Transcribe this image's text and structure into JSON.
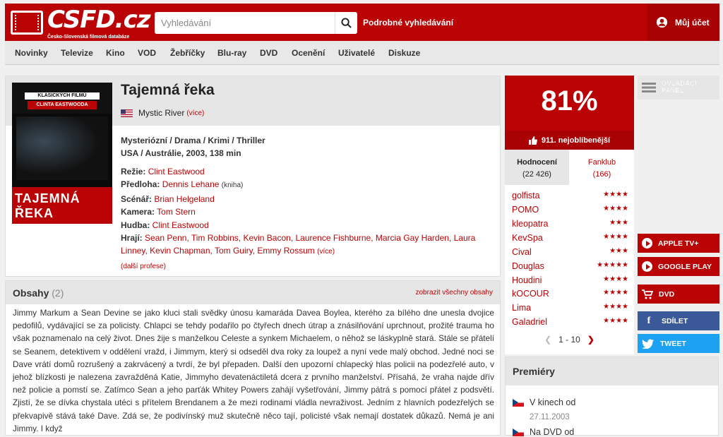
{
  "header": {
    "logo_text": "CSFD.cz",
    "logo_subtitle": "Česko-Slovenská filmová databáze",
    "search_placeholder": "Vyhledávání",
    "advanced_search": "Podrobné vyhledávání",
    "account_label": "Můj účet"
  },
  "nav": [
    "Novinky",
    "Televize",
    "Kino",
    "VOD",
    "Žebříčky",
    "Blu-ray",
    "DVD",
    "Ocenění",
    "Uživatelé",
    "Diskuze"
  ],
  "poster": {
    "top_label": "KLASICKÝCH FILMŮ",
    "director_label": "CLINTA EASTWOODA",
    "title_label": "TAJEMNÁ ŘEKA"
  },
  "film": {
    "title": "Tajemná řeka",
    "original_title": "Mystic River",
    "original_more": "(více)",
    "genres": "Mysteriózní / Drama / Krimi / Thriller",
    "origin": "USA / Austrálie, 2003, 138 min",
    "credits": {
      "director_label": "Režie:",
      "director": "Clint Eastwood",
      "source_label": "Předloha:",
      "source": "Dennis Lehane",
      "source_note": "(kniha)",
      "writer_label": "Scénář:",
      "writer": "Brian Helgeland",
      "camera_label": "Kamera:",
      "camera": "Tom Stern",
      "music_label": "Hudba:",
      "music": "Clint Eastwood",
      "cast_label": "Hrají:",
      "cast_line1": "Sean Penn, Tim Robbins, Kevin Bacon, Laurence Fishburne, Marcia Gay Harden, Laura",
      "cast_line2": "Linney, Kevin Chapman, Tom Guiry, Emmy Rossum",
      "cast_more": "(více)",
      "more_professions": "(další profese)"
    }
  },
  "plot": {
    "heading": "Obsahy",
    "count": "(2)",
    "show_all": "zobrazit všechny obsahy",
    "text": "Jimmy Markum a Sean Devine se jako kluci stali svědky únosu kamaráda Davea Boylea, kterého za bílého dne unesla dvojice pedofilů, vydávající se za policisty. Chlapci se tehdy podařilo po čtyřech dnech útrap a znásilňování uprchnout, prožité trauma ho však poznamenalo na celý život. Dnes žije s manželkou Celeste a synkem Michaelem, o něhož se láskyplně stará. Stále se přátelí se Seanem, detektivem v oddělení vražd, i Jimmym, který si odseděl dva roky za loupež a nyní vede malý obchod. Jedné noci se Dave vrátí domů rozrušený a zakrvácený a tvrdí, že byl přepaden. Další den upozorní chlapecký hlas policii na podezřelé auto, v jehož blízkosti je nalezena zavražděná Katie, Jimmyho devatenáctiletá dcera z prvního manželství. Přísahá, že vraha najde dřív než policie a pomstí se. Zatímco Sean a jeho parťák Whitey Powers zahájí vyšetřování, Jimmy pátrá s pomocí přátel z podsvětí. Zjistí, že se dívka chystala utéci s přítelem Brendanem a že mezi rodinami vládla nevraživost. Jedním z hlavních podezřelých se překvapivě stává také Dave. Zdá se, že podivínský muž skutečně něco tají, policisté však nemají dostatek důkazů. Nemá je ani Jimmy. I když"
  },
  "rating": {
    "percent": "81%",
    "rank": "911. nejoblíbenější",
    "tab_ratings": "Hodnocení",
    "tab_ratings_count": "(22 426)",
    "tab_fanclub": "Fanklub",
    "tab_fanclub_count": "(166)",
    "users": [
      {
        "name": "golfista",
        "stars": "★★★★"
      },
      {
        "name": "POMO",
        "stars": "★★★★"
      },
      {
        "name": "kleopatra",
        "stars": "★★★"
      },
      {
        "name": "KevSpa",
        "stars": "★★★★"
      },
      {
        "name": "Cival",
        "stars": "★★★"
      },
      {
        "name": "Douglas",
        "stars": "★★★★★"
      },
      {
        "name": "Houdini",
        "stars": "★★★★"
      },
      {
        "name": "kOCOUR",
        "stars": "★★★★"
      },
      {
        "name": "Lima",
        "stars": "★★★★"
      },
      {
        "name": "Galadriel",
        "stars": "★★★★"
      }
    ],
    "pager": "1 - 10"
  },
  "sidebar": {
    "panel_label": "OVLÁDACÍ PANEL",
    "apple": "APPLE TV+",
    "google": "GOOGLE PLAY",
    "dvd": "DVD",
    "share": "SDÍLET",
    "tweet": "TWEET"
  },
  "premieres": {
    "heading": "Premiéry",
    "cinema_label": "V kinech od",
    "cinema_date": "27.11.2003",
    "dvd_label": "Na DVD od"
  },
  "colors": {
    "brand": "#ba0305",
    "facebook": "#3b5998",
    "twitter": "#1da1f2"
  }
}
